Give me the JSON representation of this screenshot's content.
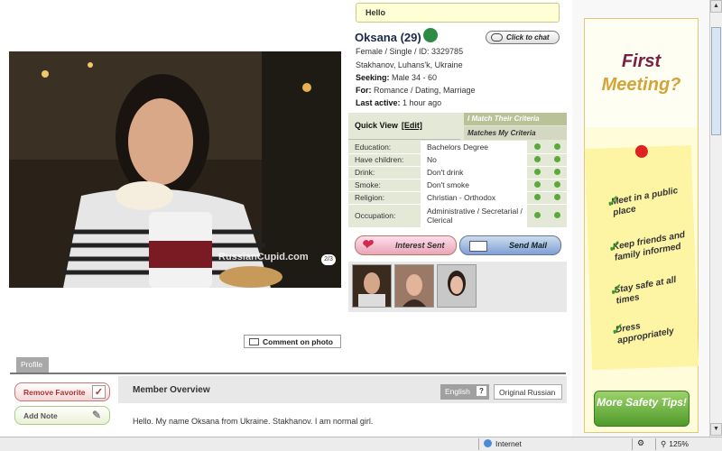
{
  "profile": {
    "greeting": "Hello",
    "name": "Oksana (29)",
    "chat_label": "Click to chat",
    "gender_status": "Female / Single / ID: 3329785",
    "location": "Stakhanov, Luhans'k, Ukraine",
    "seeking_label": "Seeking:",
    "seeking_value": "Male 34 - 60",
    "for_label": "For:",
    "for_value": "Romance / Dating, Marriage",
    "last_active_label": "Last active:",
    "last_active_value": "1 hour ago"
  },
  "photo": {
    "watermark": "RussianCupid.com",
    "count": "2/3",
    "comment_label": "Comment on photo"
  },
  "quick_view": {
    "title": "Quick View",
    "edit_label": "[Edit]",
    "match_their": "I Match Their Criteria",
    "match_mine": "Matches My Criteria",
    "rows": [
      {
        "label": "Education:",
        "value": "Bachelors Degree"
      },
      {
        "label": "Have children:",
        "value": "No"
      },
      {
        "label": "Drink:",
        "value": "Don't drink"
      },
      {
        "label": "Smoke:",
        "value": "Don't smoke"
      },
      {
        "label": "Religion:",
        "value": "Christian - Orthodox"
      },
      {
        "label": "Occupation:",
        "value": "Administrative / Secretarial / Clerical"
      }
    ]
  },
  "actions": {
    "interest_sent": "Interest Sent",
    "send_mail": "Send Mail",
    "remove_favorite": "Remove Favorite",
    "add_note": "Add Note"
  },
  "tabs": {
    "profile": "Profile"
  },
  "overview": {
    "title": "Member Overview",
    "lang_english": "English",
    "lang_help": "?",
    "lang_original": "Original Russian",
    "text": "Hello. My name Oksana from Ukraine. Stakhanov. I am normal girl."
  },
  "ad": {
    "line1": "First",
    "line2": "Meeting?",
    "tips": [
      "Meet in a public place",
      "Keep friends and family informed",
      "Stay safe at all times",
      "Dress appropriately"
    ],
    "button": "More Safety Tips!"
  },
  "statusbar": {
    "zone": "Internet",
    "zoom": "125%"
  },
  "colors": {
    "match_dot": "#5aaa3a",
    "ad_title": "#7a2045",
    "ad_accent": "#d4a33a"
  }
}
